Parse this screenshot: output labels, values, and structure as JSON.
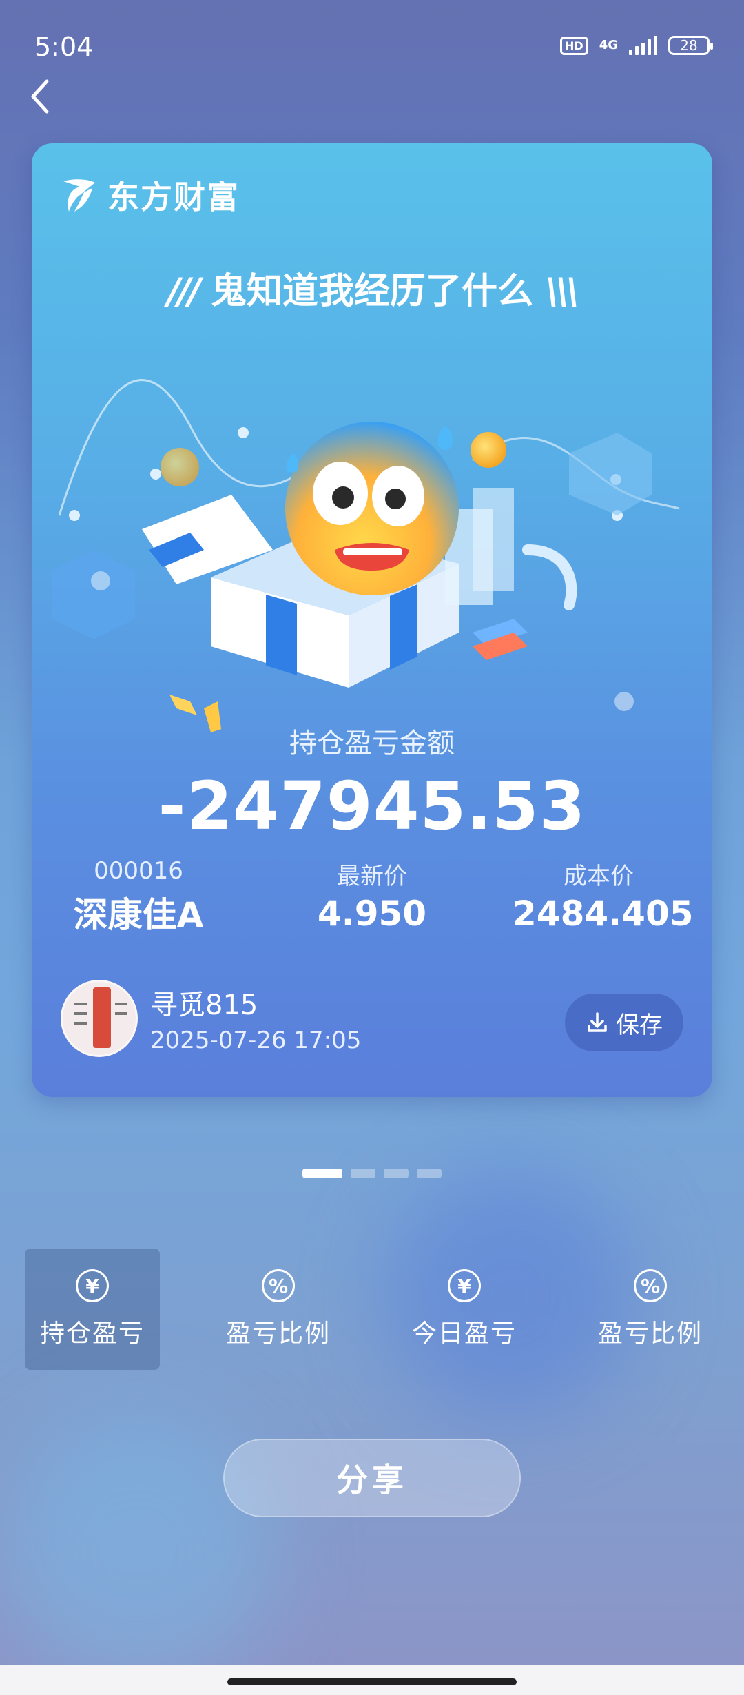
{
  "status_bar": {
    "time": "5:04",
    "hd": "HD",
    "network": "4G",
    "battery": "28"
  },
  "card": {
    "brand": "东方财富",
    "headline": "鬼知道我经历了什么",
    "pl_label": "持仓盈亏金额",
    "pl_value": "-247945.53",
    "stock": {
      "code": "000016",
      "name": "深康佳A"
    },
    "latest_price": {
      "label": "最新价",
      "value": "4.950"
    },
    "cost_price": {
      "label": "成本价",
      "value": "2484.405"
    },
    "user": {
      "name": "寻觅815",
      "datetime": "2025-07-26 17:05"
    },
    "save_label": "保存"
  },
  "pager": {
    "count": 4,
    "active_index": 0
  },
  "tabs": [
    {
      "icon": "yen-icon",
      "glyph": "¥",
      "label": "持仓盈亏",
      "active": true
    },
    {
      "icon": "percent-icon",
      "glyph": "%",
      "label": "盈亏比例",
      "active": false
    },
    {
      "icon": "yen-icon",
      "glyph": "¥",
      "label": "今日盈亏",
      "active": false
    },
    {
      "icon": "percent-icon",
      "glyph": "%",
      "label": "盈亏比例",
      "active": false
    }
  ],
  "share_label": "分享",
  "colors": {
    "accent": "#5a8ee0",
    "card_top": "#59c1ea"
  }
}
